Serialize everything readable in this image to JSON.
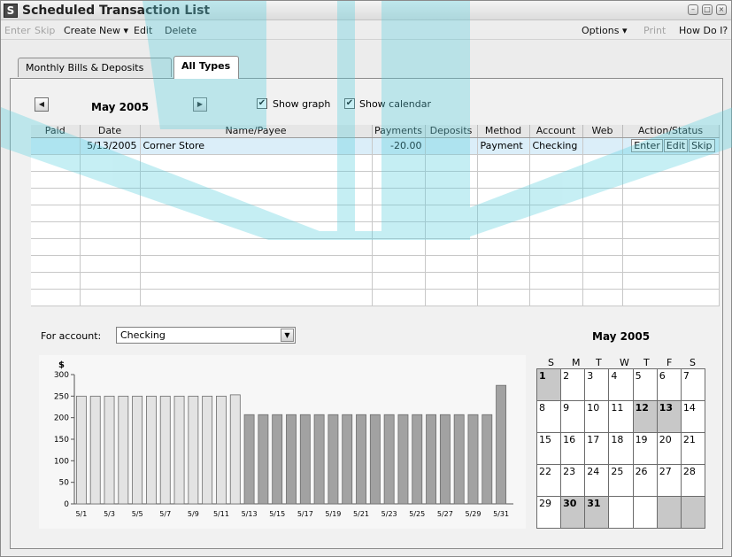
{
  "window": {
    "title": "Scheduled Transaction List",
    "minimize": "–",
    "maximize": "□",
    "close": "×",
    "app_icon": "S"
  },
  "menubar": {
    "enter": "Enter",
    "skip": "Skip",
    "create_new": "Create New ▾",
    "edit": "Edit",
    "delete": "Delete",
    "options": "Options ▾",
    "print": "Print",
    "how_do_i": "How Do I?"
  },
  "tabs": [
    "Monthly Bills & Deposits",
    "All Types"
  ],
  "toolbar": {
    "month": "May 2005",
    "prev": "◀",
    "next": "▶",
    "show_graph": "Show graph",
    "show_calendar": "Show calendar",
    "check": "✔"
  },
  "table": {
    "columns": [
      "Paid",
      "Date",
      "Name/Payee",
      "Payments",
      "Deposits",
      "Method",
      "Account",
      "Web",
      "Action/Status"
    ],
    "row": {
      "paid": "",
      "date": "5/13/2005",
      "payee": "Corner Store",
      "payments": "-20.00",
      "deposits": "",
      "method": "Payment",
      "account": "Checking",
      "web": ""
    },
    "actions": [
      "Enter",
      "Edit",
      "Skip"
    ],
    "empty_rows": 9
  },
  "for_account": {
    "label": "For account:",
    "value": "Checking",
    "arrow": "▼"
  },
  "chart_data": {
    "type": "bar",
    "ylabel": "$",
    "ylim": [
      0,
      300
    ],
    "yticks": [
      0,
      50,
      100,
      150,
      200,
      250,
      300
    ],
    "x": [
      "5/1",
      "5/2",
      "5/3",
      "5/4",
      "5/5",
      "5/6",
      "5/7",
      "5/8",
      "5/9",
      "5/10",
      "5/11",
      "5/12",
      "5/13",
      "5/14",
      "5/15",
      "5/16",
      "5/17",
      "5/18",
      "5/19",
      "5/20",
      "5/21",
      "5/22",
      "5/23",
      "5/24",
      "5/25",
      "5/26",
      "5/27",
      "5/28",
      "5/29",
      "5/30",
      "5/31"
    ],
    "xtick_labels": [
      "5/1",
      "5/3",
      "5/5",
      "5/7",
      "5/9",
      "5/11",
      "5/13",
      "5/15",
      "5/17",
      "5/19",
      "5/21",
      "5/23",
      "5/25",
      "5/27",
      "5/29",
      "5/31"
    ],
    "values": [
      250,
      250,
      250,
      250,
      250,
      250,
      250,
      250,
      250,
      250,
      250,
      253,
      207,
      207,
      207,
      207,
      207,
      207,
      207,
      207,
      207,
      207,
      207,
      207,
      207,
      207,
      207,
      207,
      207,
      207,
      275
    ],
    "colors": {
      "past": "#e3e3e3",
      "future": "#a2a2a2"
    }
  },
  "calendar": {
    "title": "May 2005",
    "dow": [
      "S",
      "M",
      "T",
      "W",
      "T",
      "F",
      "S"
    ],
    "weeks": [
      [
        "1",
        "2",
        "3",
        "4",
        "5",
        "6",
        "7"
      ],
      [
        "8",
        "9",
        "10",
        "11",
        "12",
        "13",
        "14"
      ],
      [
        "15",
        "16",
        "17",
        "18",
        "19",
        "20",
        "21"
      ],
      [
        "22",
        "23",
        "24",
        "25",
        "26",
        "27",
        "28"
      ],
      [
        "29",
        "30",
        "31",
        "",
        "",
        "",
        ""
      ]
    ],
    "highlighted": [
      "1",
      "12",
      "13",
      "30",
      "31"
    ],
    "bold": [
      "1",
      "12",
      "13",
      "30",
      "31"
    ]
  },
  "colors": {
    "watermark": "#5cd0df",
    "selected_row": "#dbeef9"
  }
}
